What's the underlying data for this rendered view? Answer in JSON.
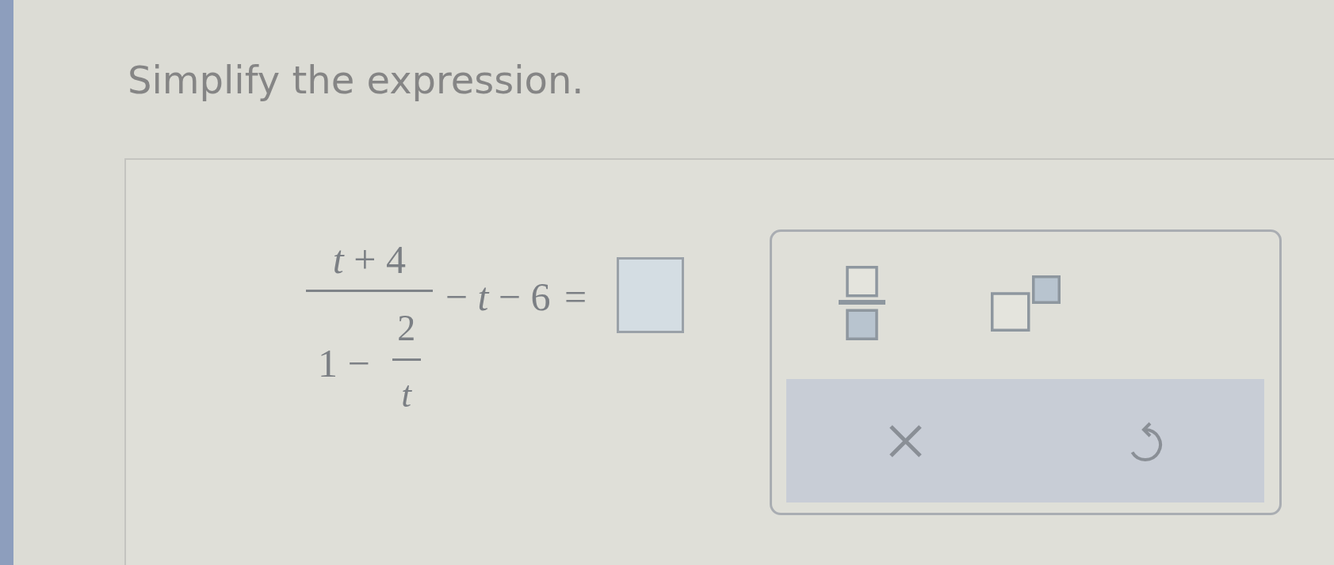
{
  "prompt": "Simplify the expression.",
  "expression": {
    "numerator": "*t*+4",
    "denominator": {
      "lead": "1 −",
      "numerator": "2",
      "denominator": "t"
    },
    "rest": "−*t*−6",
    "equals": "="
  },
  "palette": {
    "tools": [
      {
        "kind": "fraction"
      },
      {
        "kind": "exponent"
      }
    ],
    "actions": [
      {
        "kind": "clear"
      },
      {
        "kind": "undo"
      }
    ]
  }
}
